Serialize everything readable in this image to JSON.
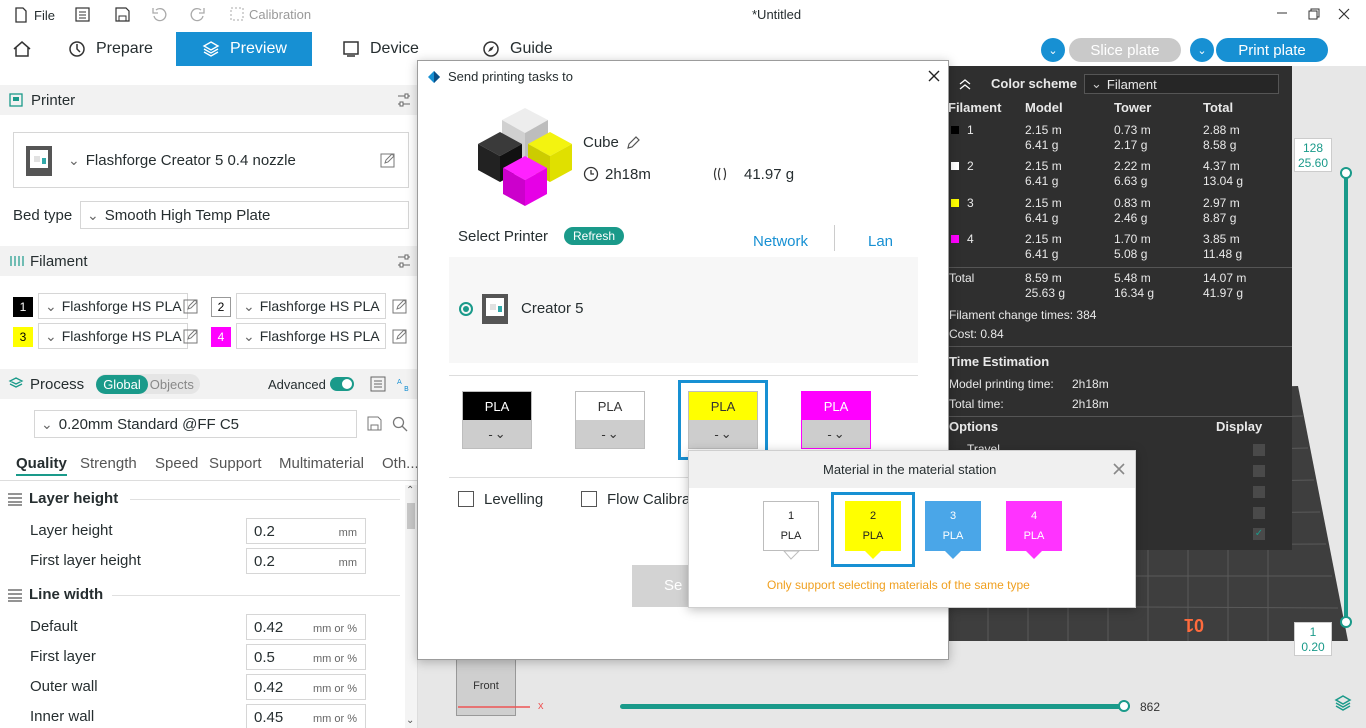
{
  "titlebar": {
    "file": "File",
    "calibration": "Calibration",
    "title": "*Untitled"
  },
  "tabs": [
    {
      "label": "Prepare"
    },
    {
      "label": "Preview"
    },
    {
      "label": "Device"
    },
    {
      "label": "Guide"
    }
  ],
  "actions": {
    "slice": "Slice plate",
    "print": "Print plate"
  },
  "left": {
    "printer_title": "Printer",
    "printer_name": "Flashforge Creator 5 0.4 nozzle",
    "bed_label": "Bed type",
    "bed_value": "Smooth High Temp Plate",
    "filament_title": "Filament",
    "filaments": [
      {
        "num": "1",
        "name": "Flashforge HS PLA",
        "color": "#000000"
      },
      {
        "num": "2",
        "name": "Flashforge HS PLA",
        "color": "#ffffff"
      },
      {
        "num": "3",
        "name": "Flashforge HS PLA",
        "color": "#ffff00"
      },
      {
        "num": "4",
        "name": "Flashforge HS PLA",
        "color": "#ff00ff"
      }
    ],
    "process_title": "Process",
    "toggle_global": "Global",
    "toggle_objects": "Objects",
    "advanced": "Advanced",
    "profile": "0.20mm Standard @FF C5",
    "subtabs": [
      "Quality",
      "Strength",
      "Speed",
      "Support",
      "Multimaterial",
      "Oth..."
    ],
    "groups": {
      "layer_height": "Layer height",
      "line_width": "Line width"
    },
    "rows": [
      {
        "label": "Layer height",
        "value": "0.2",
        "unit": "mm"
      },
      {
        "label": "First layer height",
        "value": "0.2",
        "unit": "mm"
      },
      {
        "label": "Default",
        "value": "0.42",
        "unit": "mm or %"
      },
      {
        "label": "First layer",
        "value": "0.5",
        "unit": "mm or %"
      },
      {
        "label": "Outer wall",
        "value": "0.42",
        "unit": "mm or %"
      },
      {
        "label": "Inner wall",
        "value": "0.45",
        "unit": "mm or %"
      }
    ]
  },
  "legend": {
    "color_scheme_label": "Color scheme",
    "color_scheme_value": "Filament",
    "headers": [
      "Filament",
      "Model",
      "Tower",
      "Total"
    ],
    "rows": [
      {
        "num": "1",
        "color": "#000000",
        "model": [
          "2.15 m",
          "6.41 g"
        ],
        "tower": [
          "0.73 m",
          "2.17 g"
        ],
        "total": [
          "2.88 m",
          "8.58 g"
        ]
      },
      {
        "num": "2",
        "color": "#ffffff",
        "model": [
          "2.15 m",
          "6.41 g"
        ],
        "tower": [
          "2.22 m",
          "6.63 g"
        ],
        "total": [
          "4.37 m",
          "13.04 g"
        ]
      },
      {
        "num": "3",
        "color": "#ffff00",
        "model": [
          "2.15 m",
          "6.41 g"
        ],
        "tower": [
          "0.83 m",
          "2.46 g"
        ],
        "total": [
          "2.97 m",
          "8.87 g"
        ]
      },
      {
        "num": "4",
        "color": "#ff00ff",
        "model": [
          "2.15 m",
          "6.41 g"
        ],
        "tower": [
          "1.70 m",
          "5.08 g"
        ],
        "total": [
          "3.85 m",
          "11.48 g"
        ]
      }
    ],
    "total_label": "Total",
    "total": {
      "model": [
        "8.59 m",
        "25.63 g"
      ],
      "tower": [
        "5.48 m",
        "16.34 g"
      ],
      "total": [
        "14.07 m",
        "41.97 g"
      ]
    },
    "change_times": "Filament change times:  384",
    "cost": "Cost:  0.84",
    "time_title": "Time Estimation",
    "model_time_label": "Model printing time:",
    "model_time": "2h18m",
    "total_time_label": "Total time:",
    "total_time": "2h18m",
    "options": "Options",
    "display": "Display",
    "travel": "Travel"
  },
  "viewport": {
    "slider_top_a": "128",
    "slider_top_b": "25.60",
    "slider_bot_a": "1",
    "slider_bot_b": "0.20",
    "h_slider_value": "862",
    "front": "Front",
    "axis_x": "x",
    "plate_label": "01"
  },
  "dialog": {
    "title": "Send printing tasks to",
    "model_name": "Cube",
    "time": "2h18m",
    "weight": "41.97 g",
    "select_printer": "Select Printer",
    "refresh": "Refresh",
    "network": "Network",
    "lan": "Lan",
    "printer": "Creator 5",
    "materials": [
      {
        "label": "PLA",
        "color": "#000000",
        "text": "#ffffff",
        "sel": "- "
      },
      {
        "label": "PLA",
        "color": "#ffffff",
        "text": "#333333",
        "sel": "- "
      },
      {
        "label": "PLA",
        "color": "#ffff00",
        "text": "#333333",
        "sel": "- "
      },
      {
        "label": "PLA",
        "color": "#ff00ff",
        "text": "#ffffff",
        "sel": "- "
      }
    ],
    "levelling": "Levelling",
    "flow": "Flow Calibra",
    "send": "Se"
  },
  "popup": {
    "title": "Material in the material station",
    "slots": [
      {
        "num": "1",
        "label": "PLA",
        "color": "#ffffff",
        "text": "#222222"
      },
      {
        "num": "2",
        "label": "PLA",
        "color": "#ffff00",
        "text": "#222222"
      },
      {
        "num": "3",
        "label": "PLA",
        "color": "#4aa6e8",
        "text": "#ffffff"
      },
      {
        "num": "4",
        "label": "PLA",
        "color": "#ff33ff",
        "text": "#ffffff"
      }
    ],
    "note": "Only support selecting materials of the same type"
  }
}
